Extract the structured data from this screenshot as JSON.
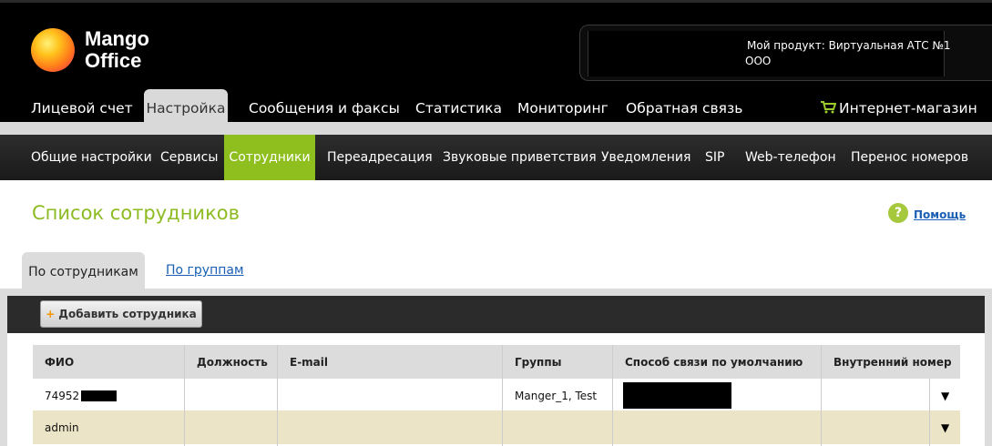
{
  "brand": {
    "logo_line1": "Mango",
    "logo_line2": "Office"
  },
  "product": {
    "label": "Мой продукт:  Виртуальная АТС №1",
    "company": "ООО"
  },
  "topnav": {
    "tabs": [
      "Лицевой счет",
      "Настройка",
      "Сообщения и факсы",
      "Статистика",
      "Мониторинг",
      "Обратная связь"
    ],
    "active": "Настройка",
    "shop": "Интернет-магазин"
  },
  "subnav": {
    "items": [
      "Общие настройки",
      "Сервисы",
      "Сотрудники",
      "Переадресация",
      "Звуковые приветствия",
      "Уведомления",
      "SIP",
      "Web-телефон",
      "Перенос номеров"
    ],
    "active": "Сотрудники"
  },
  "page": {
    "title": "Список сотрудников",
    "help": "Помощь",
    "help_icon": "?"
  },
  "view_tabs": {
    "by_employees": "По сотрудникам",
    "by_groups": "По группам"
  },
  "toolbar": {
    "add_plus": "+",
    "add_label": "Добавить сотрудника"
  },
  "table": {
    "columns": [
      "ФИО",
      "Должность",
      "E-mail",
      "Группы",
      "Способ связи по умолчанию",
      "Внутренний номер"
    ],
    "rows": [
      {
        "name": "74952",
        "position": "",
        "email": "",
        "groups": "Manger_1, Test",
        "contact": "",
        "ext": ""
      },
      {
        "name": "admin",
        "position": "",
        "email": "",
        "groups": "",
        "contact": "",
        "ext": ""
      }
    ],
    "dropdown_glyph": "▼"
  },
  "colors": {
    "accent_green": "#8fbf1f",
    "title_green": "#8dbb22",
    "link_blue": "#1a5fb4",
    "row_highlight": "#ece4c6"
  }
}
